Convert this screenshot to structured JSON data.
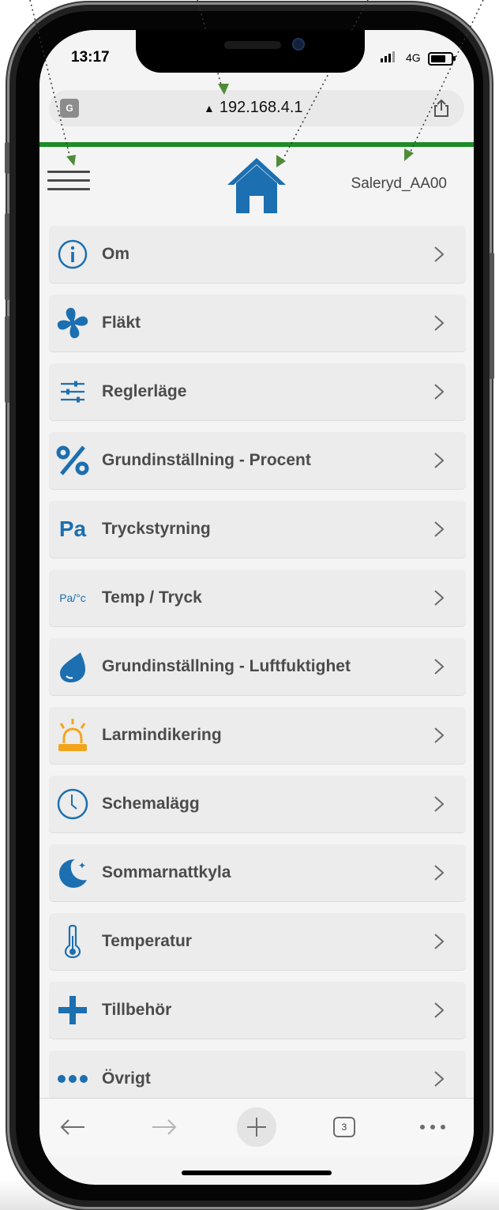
{
  "status_bar": {
    "time": "13:17",
    "network": "4G"
  },
  "browser": {
    "url": "192.168.4.1",
    "warning_glyph": "▲",
    "translate_label": "G"
  },
  "header": {
    "device_name": "Saleryd_AA00"
  },
  "colors": {
    "accent_blue": "#1c6fb0",
    "progress_green": "#1d8b26",
    "alarm_orange": "#f2a51c",
    "label_gray": "#4b4b4b"
  },
  "menu": [
    {
      "label": "Om",
      "icon": "info-icon"
    },
    {
      "label": "Fläkt",
      "icon": "fan-icon"
    },
    {
      "label": "Reglerläge",
      "icon": "sliders-icon"
    },
    {
      "label": "Grundinställning - Procent",
      "icon": "percent-icon"
    },
    {
      "label": "Tryckstyrning",
      "icon": "pa-icon",
      "icon_text": "Pa"
    },
    {
      "label": "Temp / Tryck",
      "icon": "pa-per-celsius-icon",
      "icon_text": "Pa/°c"
    },
    {
      "label": "Grundinställning - Luftfuktighet",
      "icon": "water-drop-icon"
    },
    {
      "label": "Larmindikering",
      "icon": "alarm-light-icon"
    },
    {
      "label": "Schemalägg",
      "icon": "clock-icon"
    },
    {
      "label": "Sommarnattkyla",
      "icon": "moon-icon"
    },
    {
      "label": "Temperatur",
      "icon": "thermometer-icon"
    },
    {
      "label": "Tillbehör",
      "icon": "plus-icon"
    },
    {
      "label": "Övrigt",
      "icon": "more-dots-icon"
    }
  ],
  "toolbar": {
    "tab_count": "3"
  }
}
